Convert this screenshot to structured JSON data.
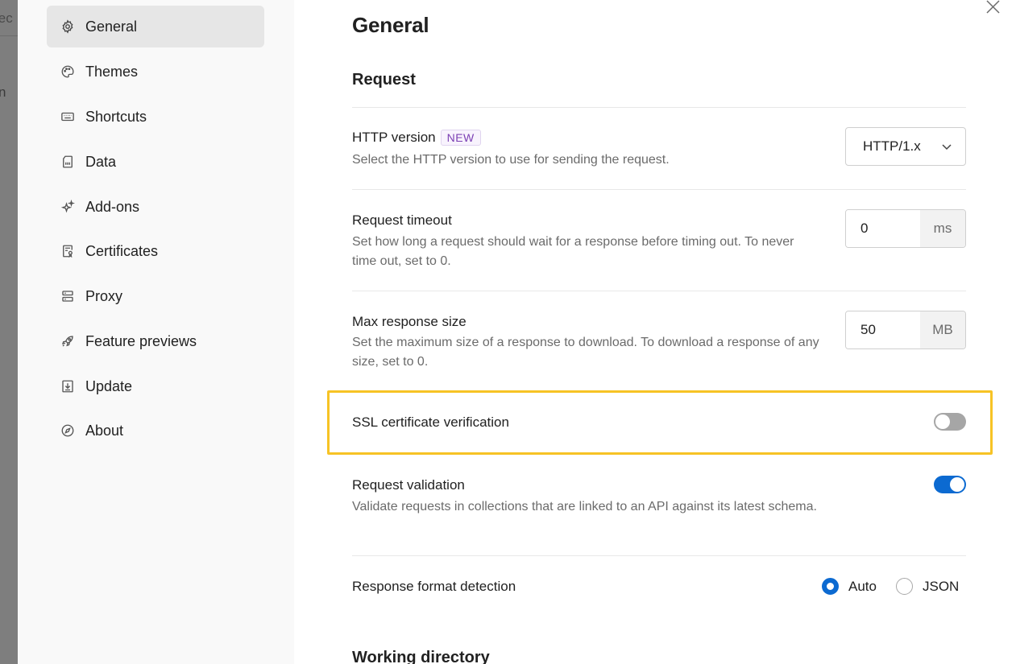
{
  "background": {
    "fragment_top": "lec",
    "fragment_mid": "n"
  },
  "sidebar": {
    "items": [
      {
        "label": "General",
        "icon": "gear-icon",
        "active": true
      },
      {
        "label": "Themes",
        "icon": "palette-icon",
        "active": false
      },
      {
        "label": "Shortcuts",
        "icon": "keyboard-icon",
        "active": false
      },
      {
        "label": "Data",
        "icon": "data-icon",
        "active": false
      },
      {
        "label": "Add-ons",
        "icon": "sparkle-icon",
        "active": false
      },
      {
        "label": "Certificates",
        "icon": "certificate-icon",
        "active": false
      },
      {
        "label": "Proxy",
        "icon": "server-icon",
        "active": false
      },
      {
        "label": "Feature previews",
        "icon": "rocket-icon",
        "active": false
      },
      {
        "label": "Update",
        "icon": "download-icon",
        "active": false
      },
      {
        "label": "About",
        "icon": "compass-icon",
        "active": false
      }
    ]
  },
  "main": {
    "title": "General",
    "section_request": "Request",
    "http_version": {
      "title": "HTTP version",
      "badge": "NEW",
      "desc": "Select the HTTP version to use for sending the request.",
      "value": "HTTP/1.x"
    },
    "request_timeout": {
      "title": "Request timeout",
      "desc": "Set how long a request should wait for a response before timing out. To never time out, set to 0.",
      "value": "0",
      "unit": "ms"
    },
    "max_response_size": {
      "title": "Max response size",
      "desc": "Set the maximum size of a response to download. To download a response of any size, set to 0.",
      "value": "50",
      "unit": "MB"
    },
    "ssl_verification": {
      "title": "SSL certificate verification",
      "enabled": false
    },
    "request_validation": {
      "title": "Request validation",
      "desc": "Validate requests in collections that are linked to an API against its latest schema.",
      "enabled": true
    },
    "response_format": {
      "title": "Response format detection",
      "options": [
        "Auto",
        "JSON"
      ],
      "selected": "Auto"
    },
    "section_working_dir": "Working directory"
  },
  "colors": {
    "accent": "#0c6ad1",
    "highlight": "#f7c325",
    "badge": "#7b3fb4"
  }
}
